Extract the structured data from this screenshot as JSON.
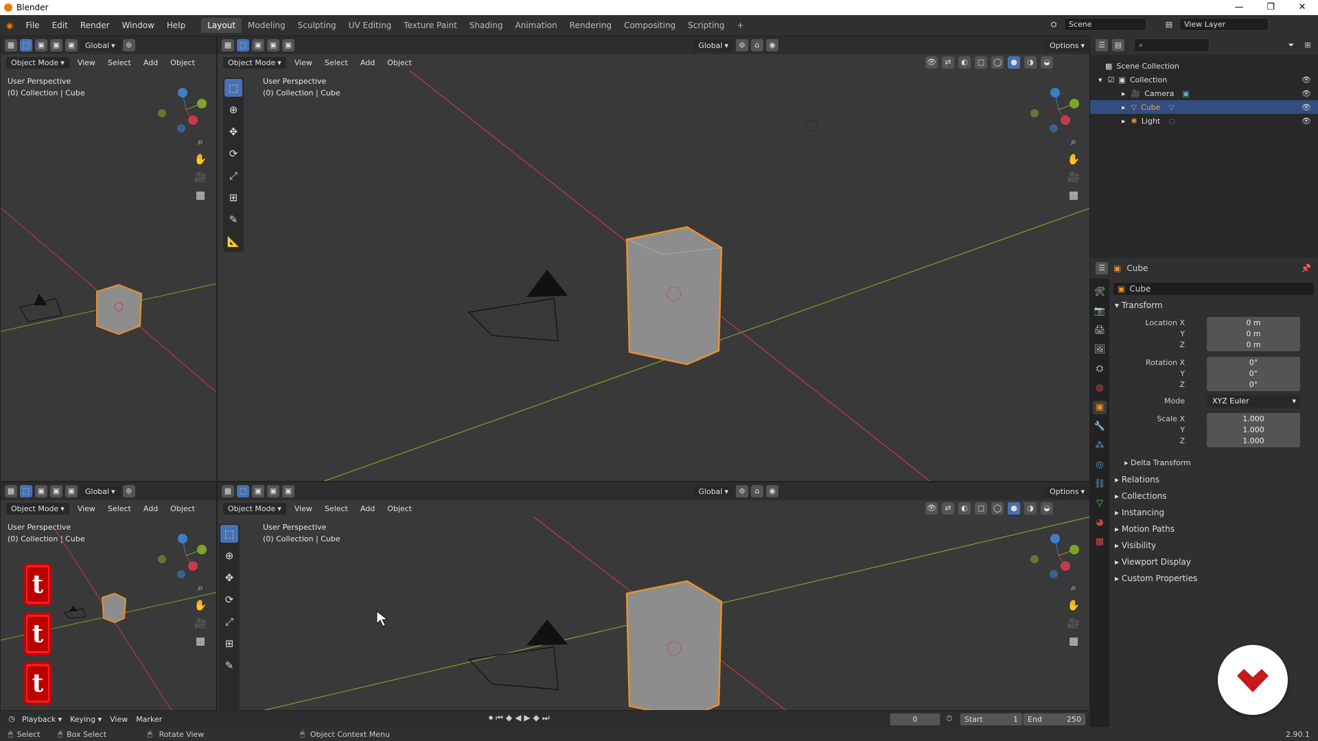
{
  "window": {
    "title": "Blender",
    "controls": [
      "—",
      "❐",
      "✕"
    ]
  },
  "menu": [
    "File",
    "Edit",
    "Render",
    "Window",
    "Help"
  ],
  "workspaces": [
    "Layout",
    "Modeling",
    "Sculpting",
    "UV Editing",
    "Texture Paint",
    "Shading",
    "Animation",
    "Rendering",
    "Compositing",
    "Scripting"
  ],
  "workspace_add": "+",
  "active_workspace": "Layout",
  "scene": "Scene",
  "view_layer": "View Layer",
  "viewport": {
    "orientation": "Global",
    "mode": "Object Mode",
    "menus": [
      "View",
      "Select",
      "Add",
      "Object"
    ],
    "options": "Options",
    "info_line1": "User Perspective",
    "info_line2": "(0) Collection | Cube"
  },
  "outliner": {
    "root": "Scene Collection",
    "collection": "Collection",
    "items": [
      {
        "name": "Camera",
        "selected": false
      },
      {
        "name": "Cube",
        "selected": true
      },
      {
        "name": "Light",
        "selected": false
      }
    ]
  },
  "properties": {
    "object_name": "Cube",
    "data_name": "Cube",
    "panel": "Transform",
    "location": {
      "label": "Location X",
      "x": "0 m",
      "y": "0 m",
      "z": "0 m"
    },
    "rotation": {
      "label": "Rotation X",
      "x": "0°",
      "y": "0°",
      "z": "0°"
    },
    "mode_label": "Mode",
    "mode_value": "XYZ Euler",
    "scale": {
      "label": "Scale X",
      "x": "1.000",
      "y": "1.000",
      "z": "1.000"
    },
    "axis_y": "Y",
    "axis_z": "Z",
    "delta": "Delta Transform",
    "sections": [
      "Relations",
      "Collections",
      "Instancing",
      "Motion Paths",
      "Visibility",
      "Viewport Display",
      "Custom Properties"
    ]
  },
  "timeline": {
    "menus": [
      "Playback",
      "Keying",
      "View",
      "Marker"
    ],
    "current_frame": "0",
    "start_label": "Start",
    "start": "1",
    "end_label": "End",
    "end": "250"
  },
  "statusbar": {
    "select": "Select",
    "box_select": "Box Select",
    "rotate_view": "Rotate View",
    "context_menu": "Object Context Menu",
    "version": "2.90.1"
  },
  "overlay_buttons": [
    "t",
    "t",
    "t"
  ],
  "colors": {
    "accent": "#4772b3",
    "selected_outline": "#e8912d",
    "x_axis": "#c43a4a",
    "y_axis": "#7ea329"
  }
}
